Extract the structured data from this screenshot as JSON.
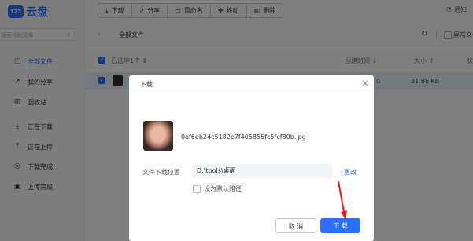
{
  "app": {
    "logo_mark": "123",
    "logo_text": "云盘"
  },
  "search": {
    "placeholder": "搜索你的文件"
  },
  "sidebar": {
    "items": [
      {
        "label": "全部文件",
        "icon": "folder-icon"
      },
      {
        "label": "我的分享",
        "icon": "share-icon"
      },
      {
        "label": "回收站",
        "icon": "trash-icon"
      },
      {
        "label": "正在下载",
        "icon": "download-icon"
      },
      {
        "label": "正在上传",
        "icon": "upload-icon"
      },
      {
        "label": "下载完成",
        "icon": "check-circle-icon"
      },
      {
        "label": "上传完成",
        "icon": "upload-done-icon"
      }
    ]
  },
  "toolbar": {
    "buttons": [
      {
        "label": "下载",
        "icon": "download-icon"
      },
      {
        "label": "分享",
        "icon": "share-icon"
      },
      {
        "label": "重命名",
        "icon": "rename-icon"
      },
      {
        "label": "移动",
        "icon": "move-icon"
      },
      {
        "label": "删除",
        "icon": "trash-icon"
      }
    ]
  },
  "notify": {
    "label": "通知"
  },
  "breadcrumb": {
    "label": "全部文件"
  },
  "filter": {
    "exception_label": "异常文件"
  },
  "table": {
    "selected_label": "已选中1个",
    "col_created": "创建时间",
    "col_size": "大小",
    "col_status": "状态",
    "row_time_fragment": "0",
    "row_size": "31.86 KB"
  },
  "dialog": {
    "title": "下载",
    "file_name": "0af6eb24c5182e7f405855fc5fcf80b.jpg",
    "location_label": "文件下载位置",
    "location_value": "D:\\tools\\桌面",
    "change_label": "更改",
    "default_label": "设为默认路径",
    "cancel_label": "取 消",
    "download_label": "下 载"
  },
  "colors": {
    "accent": "#2b6fff",
    "annotation_arrow": "#e02020"
  }
}
